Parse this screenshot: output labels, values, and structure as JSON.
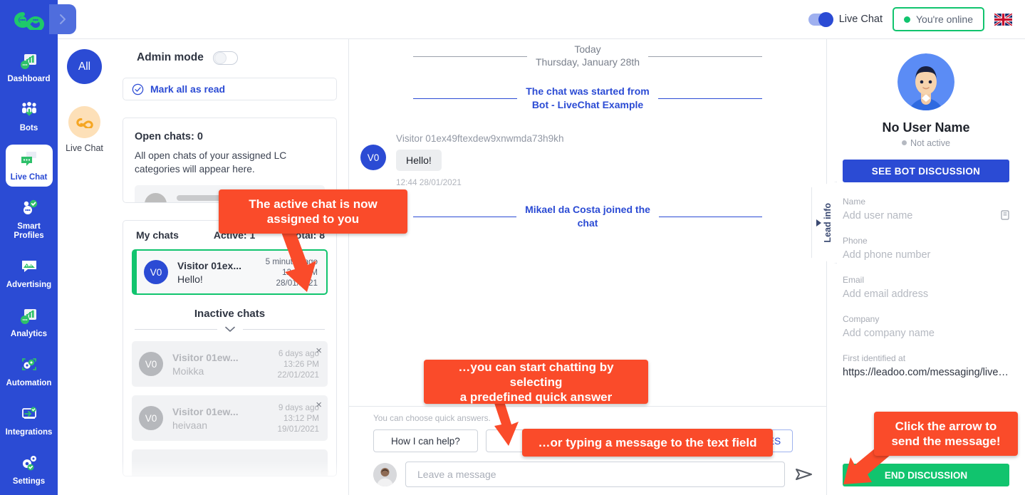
{
  "topbar": {
    "livechat_toggle_label": "Live Chat",
    "online_label": "You're online",
    "flag_name": "uk-flag-icon"
  },
  "rail": {
    "logo_name": "leadoo-logo",
    "items": [
      {
        "label": "Dashboard",
        "icon": "dashboard-icon",
        "active": false
      },
      {
        "label": "Bots",
        "icon": "bots-icon",
        "active": false
      },
      {
        "label": "Live Chat",
        "icon": "live-chat-icon",
        "active": true
      },
      {
        "label": "Smart Profiles",
        "icon": "smart-profiles-icon",
        "active": false
      },
      {
        "label": "Advertising",
        "icon": "advertising-icon",
        "active": false
      },
      {
        "label": "Analytics",
        "icon": "analytics-icon",
        "active": false
      },
      {
        "label": "Automation",
        "icon": "automation-icon",
        "active": false
      },
      {
        "label": "Integrations",
        "icon": "integrations-icon",
        "active": false
      },
      {
        "label": "Settings",
        "icon": "settings-icon",
        "active": false
      }
    ]
  },
  "categories": {
    "all_label": "All",
    "livechat_label": "Live Chat"
  },
  "list": {
    "admin_mode_label": "Admin mode",
    "mark_all_read_label": "Mark all as read",
    "open_chats_title": "Open chats: 0",
    "open_chats_desc": "All open chats of your assigned LC categories will appear here.",
    "my_chats_label": "My chats",
    "active_label": "Active: 1",
    "total_label": "Total: 8",
    "inactive_header": "Inactive chats",
    "active_chat": {
      "avatar": "V0",
      "name": "Visitor 01ex...",
      "message": "Hello!",
      "ago": "5 minutes ago",
      "time": "12:44 PM",
      "date": "28/01/2021"
    },
    "inactive_chats": [
      {
        "avatar": "V0",
        "name": "Visitor 01ew...",
        "message": "Moikka",
        "ago": "6 days ago",
        "time": "13:26 PM",
        "date": "22/01/2021",
        "close": "×"
      },
      {
        "avatar": "V0",
        "name": "Visitor 01ew...",
        "message": "heivaan",
        "ago": "9 days ago",
        "time": "13:12 PM",
        "date": "19/01/2021",
        "close": "×"
      }
    ]
  },
  "chat": {
    "day_today": "Today",
    "day_date": "Thursday, January 28th",
    "started_from_line1": "The chat was started from",
    "started_from_line2": "Bot - LiveChat Example",
    "message": {
      "avatar": "V0",
      "sender": "Visitor 01ex49ftexdew9xnwmda73h9kh",
      "text": "Hello!",
      "time": "12:44 28/01/2021"
    },
    "joined_line1": "Mikael da Costa joined the",
    "joined_line2": "chat"
  },
  "composer": {
    "quick_hint": "You can choose quick answers.",
    "quick_answer_1": "How I can help?",
    "quick_answer_2": "",
    "predefines_label": "PREDEFINES",
    "input_placeholder": "Leave a message",
    "input_value": "",
    "send_icon": "send-arrow-icon"
  },
  "lead": {
    "tab_label": "Lead info",
    "profile_name": "No User Name",
    "status": "Not active",
    "see_bot_discussion": "SEE BOT DISCUSSION",
    "fields": [
      {
        "label": "Name",
        "value": "Add user name",
        "filled": false
      },
      {
        "label": "Phone",
        "value": "Add phone number",
        "filled": false
      },
      {
        "label": "Email",
        "value": "Add email address",
        "filled": false
      },
      {
        "label": "Company",
        "value": "Add company name",
        "filled": false
      },
      {
        "label": "First identified at",
        "value": "https://leadoo.com/messaging/live-ch...",
        "filled": true
      }
    ],
    "end_discussion": "END DISCUSSION"
  },
  "callouts": [
    {
      "id": "assigned",
      "line1": "The active chat is now",
      "line2": "assigned to you"
    },
    {
      "id": "quickanswer",
      "line1": "…you can start chatting by selecting",
      "line2": "a predefined quick answer"
    },
    {
      "id": "typing",
      "line1": "…or typing a message to the text field",
      "line2": ""
    },
    {
      "id": "sendarrow",
      "line1": "Click the arrow to",
      "line2": "send the message!"
    }
  ],
  "colors": {
    "brand_blue": "#2b4bd4",
    "green": "#11c46e",
    "callout_red": "#fa4b2a",
    "orange": "#f5a623"
  }
}
